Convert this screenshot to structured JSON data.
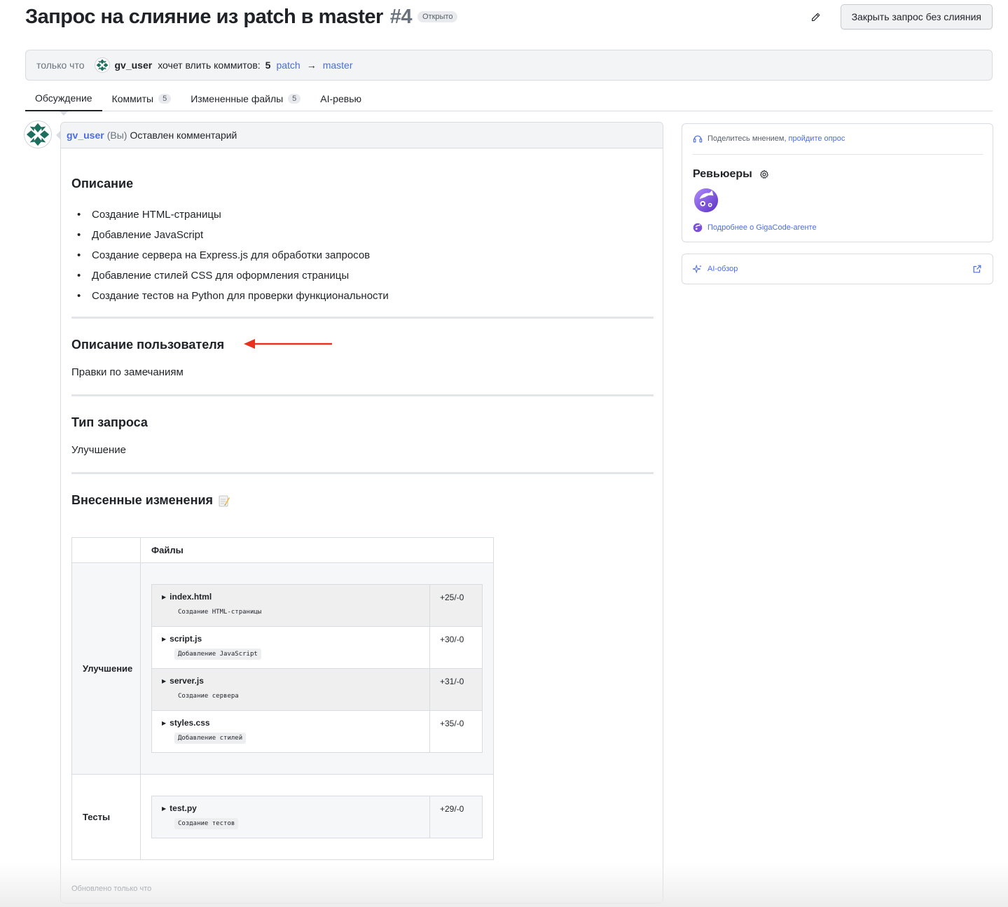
{
  "header": {
    "title": "Запрос на слияние из patch в master",
    "number": "#4",
    "state": "Открыто",
    "close_button": "Закрыть запрос без слияния"
  },
  "info": {
    "time": "только что",
    "user": "gv_user",
    "message": "хочет влить коммитов:",
    "commit_count": "5",
    "source_branch": "patch",
    "arrow": "→",
    "target_branch": "master"
  },
  "tabs": [
    {
      "label": "Обсуждение",
      "count": ""
    },
    {
      "label": "Коммиты",
      "count": "5"
    },
    {
      "label": "Измененные файлы",
      "count": "5"
    },
    {
      "label": "AI-ревью",
      "count": ""
    }
  ],
  "comment": {
    "user": "gv_user",
    "you": "(Вы)",
    "action": "Оставлен комментарий",
    "description_heading": "Описание",
    "description_items": [
      "Создание HTML-страницы",
      "Добавление JavaScript",
      "Создание сервера на Express.js для обработки запросов",
      "Добавление стилей CSS для оформления страницы",
      "Создание тестов на Python для проверки функциональности"
    ],
    "user_desc_heading": "Описание пользователя",
    "user_desc_text": "Правки по замечаниям",
    "type_heading": "Тип запроса",
    "type_text": "Улучшение",
    "changes_heading": "Внесенные изменения",
    "table": {
      "header": "Файлы",
      "groups": [
        {
          "category": "Улучшение",
          "files": [
            {
              "name": "index.html",
              "desc": "Создание HTML-страницы",
              "diff": "+25/-0"
            },
            {
              "name": "script.js",
              "desc": "Добавление JavaScript",
              "diff": "+30/-0"
            },
            {
              "name": "server.js",
              "desc": "Создание сервера",
              "diff": "+31/-0"
            },
            {
              "name": "styles.css",
              "desc": "Добавление стилей",
              "diff": "+35/-0"
            }
          ]
        },
        {
          "category": "Тесты",
          "files": [
            {
              "name": "test.py",
              "desc": "Создание тестов",
              "diff": "+29/-0"
            }
          ]
        }
      ]
    },
    "updated": "Обновлено только что"
  },
  "sidebar": {
    "survey_text": "Поделитесь мнением,",
    "survey_link": "пройдите опрос",
    "reviewers_title": "Ревьюеры",
    "giga_link": "Подробнее о GigaCode-агенте",
    "ai_overview": "AI-обзор"
  },
  "colors": {
    "link": "#4a6ee0",
    "annotation_arrow": "#e8321e",
    "giga_purple": "#7b4fd8"
  },
  "icons": [
    "pencil-icon",
    "avatar-pattern-icon",
    "arrow-right-icon",
    "gear-icon",
    "headset-icon",
    "sparkle-icon",
    "external-link-icon",
    "memo-icon",
    "caret-right-icon"
  ]
}
